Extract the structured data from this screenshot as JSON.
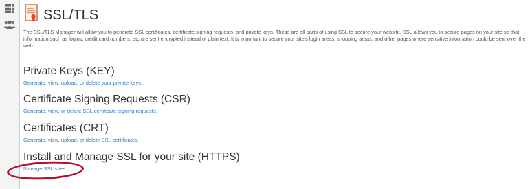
{
  "sidebar": {
    "apps_icon": "grid-icon",
    "users_icon": "users-icon"
  },
  "header": {
    "icon": "certificate-icon",
    "title": "SSL/TLS"
  },
  "intro": {
    "text": "The SSL/TLS Manager will allow you to generate SSL certificates, certificate signing requests, and private keys. These are all parts of using SSL to secure your website. SSL allows you to secure pages on your site so that information such as logins, credit card numbers, etc are sent encrypted instead of plain text. It is important to secure your site's login areas, shopping areas, and other pages where sensitive information could be sent over the web."
  },
  "sections": [
    {
      "title": "Private Keys (KEY)",
      "link": "Generate, view, upload, or delete your private keys."
    },
    {
      "title": "Certificate Signing Requests (CSR)",
      "link": "Generate, view, or delete SSL certificate signing requests."
    },
    {
      "title": "Certificates (CRT)",
      "link": "Generate, view, upload, or delete SSL certificates."
    },
    {
      "title": "Install and Manage SSL for your site (HTTPS)",
      "link": "Manage SSL sites."
    }
  ],
  "colors": {
    "link": "#3a78c0",
    "highlight": "#b3122a"
  }
}
